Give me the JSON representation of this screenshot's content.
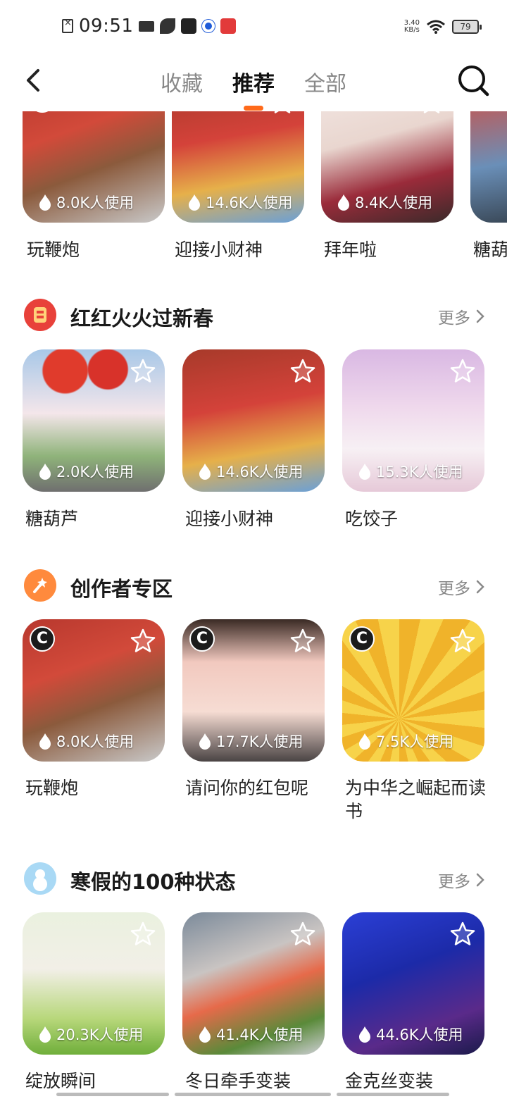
{
  "status_bar": {
    "time": "09:51",
    "speed_value": "3.40",
    "speed_unit": "KB/s",
    "battery": "79"
  },
  "header": {
    "tabs": [
      {
        "label": "收藏"
      },
      {
        "label": "推荐"
      },
      {
        "label": "全部"
      }
    ],
    "active_tab": "推荐"
  },
  "top_row": [
    {
      "title": "玩鞭炮",
      "usage": "8.0K人使用"
    },
    {
      "title": "迎接小财神",
      "usage": "14.6K人使用"
    },
    {
      "title": "拜年啦",
      "usage": "8.4K人使用"
    },
    {
      "title": "糖葫"
    }
  ],
  "sections": [
    {
      "title": "红红火火过新春",
      "more": "更多",
      "items": [
        {
          "title": "糖葫芦",
          "usage": "2.0K人使用"
        },
        {
          "title": "迎接小财神",
          "usage": "14.6K人使用"
        },
        {
          "title": "吃饺子",
          "usage": "15.3K人使用"
        }
      ]
    },
    {
      "title": "创作者专区",
      "more": "更多",
      "items": [
        {
          "title": "玩鞭炮",
          "usage": "8.0K人使用",
          "badge": "C"
        },
        {
          "title": "请问你的红包呢",
          "usage": "17.7K人使用",
          "badge": "C"
        },
        {
          "title": "为中华之崛起而读书",
          "usage": "7.5K人使用",
          "badge": "C"
        }
      ]
    },
    {
      "title": "寒假的100种状态",
      "more": "更多",
      "items": [
        {
          "title": "绽放瞬间",
          "usage": "20.3K人使用"
        },
        {
          "title": "冬日牵手变装",
          "usage": "41.4K人使用"
        },
        {
          "title": "金克丝变装",
          "usage": "44.6K人使用"
        }
      ]
    }
  ],
  "colors": {
    "accent": "#ff6a1a",
    "section_icon_1": "#e8413a",
    "section_icon_2": "#ff8a3d",
    "section_icon_3": "#a9d9f5"
  }
}
